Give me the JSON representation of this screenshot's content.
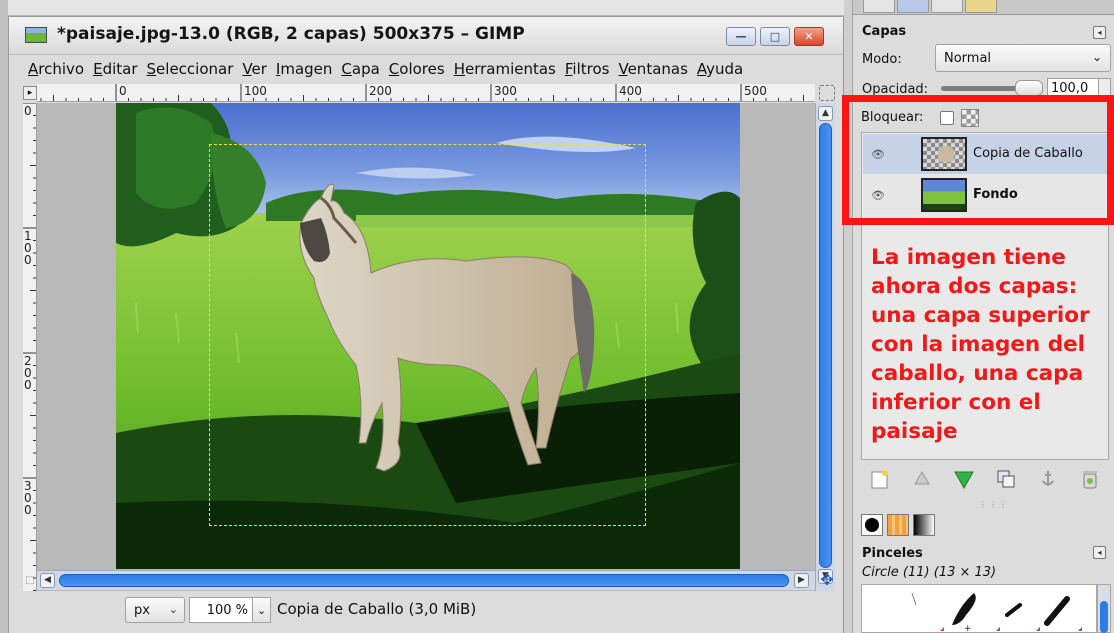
{
  "window": {
    "title": "*paisaje.jpg-13.0 (RGB, 2 capas) 500x375 – GIMP",
    "buttons": {
      "minimize": "—",
      "maximize": "□",
      "close": "✕"
    }
  },
  "menubar": {
    "items": [
      {
        "u": "A",
        "rest": "rchivo"
      },
      {
        "u": "E",
        "rest": "ditar"
      },
      {
        "u": "S",
        "rest": "eleccionar"
      },
      {
        "u": "V",
        "rest": "er"
      },
      {
        "u": "I",
        "rest": "magen"
      },
      {
        "u": "C",
        "rest": "apa"
      },
      {
        "u": "C",
        "rest": "olores"
      },
      {
        "u": "H",
        "rest": "erramientas"
      },
      {
        "u": "F",
        "rest": "iltros"
      },
      {
        "u": "V",
        "rest": "entanas"
      },
      {
        "u": "A",
        "rest": "yuda"
      }
    ]
  },
  "rulers": {
    "horizontal_labels": [
      "0",
      "100",
      "200",
      "300",
      "400",
      "500"
    ],
    "vertical_labels": [
      "0",
      "100",
      "200",
      "300"
    ]
  },
  "statusbar": {
    "unit": "px",
    "zoom": "100 %",
    "info": "Copia de Caballo (3,0 MiB)"
  },
  "layers_panel": {
    "title": "Capas",
    "mode_label": "Modo:",
    "mode_value": "Normal",
    "opacity_label": "Opacidad:",
    "opacity_value": "100,0",
    "lock_label": "Bloquear:",
    "layers": [
      {
        "name": "Copia de Caballo",
        "selected": true
      },
      {
        "name": "Fondo",
        "selected": false
      }
    ]
  },
  "annotation": {
    "text": "La imagen tiene ahora dos capas: una capa superior con la imagen del caballo, una capa inferior con el paisaje",
    "color": "#f01818"
  },
  "brushes_panel": {
    "title": "Pinceles",
    "subtitle": "Circle (11) (13 × 13)"
  },
  "colors": {
    "accent_blue": "#2d7de8",
    "highlight_red": "#ff1414",
    "selected_row": "#c6d3e7"
  }
}
